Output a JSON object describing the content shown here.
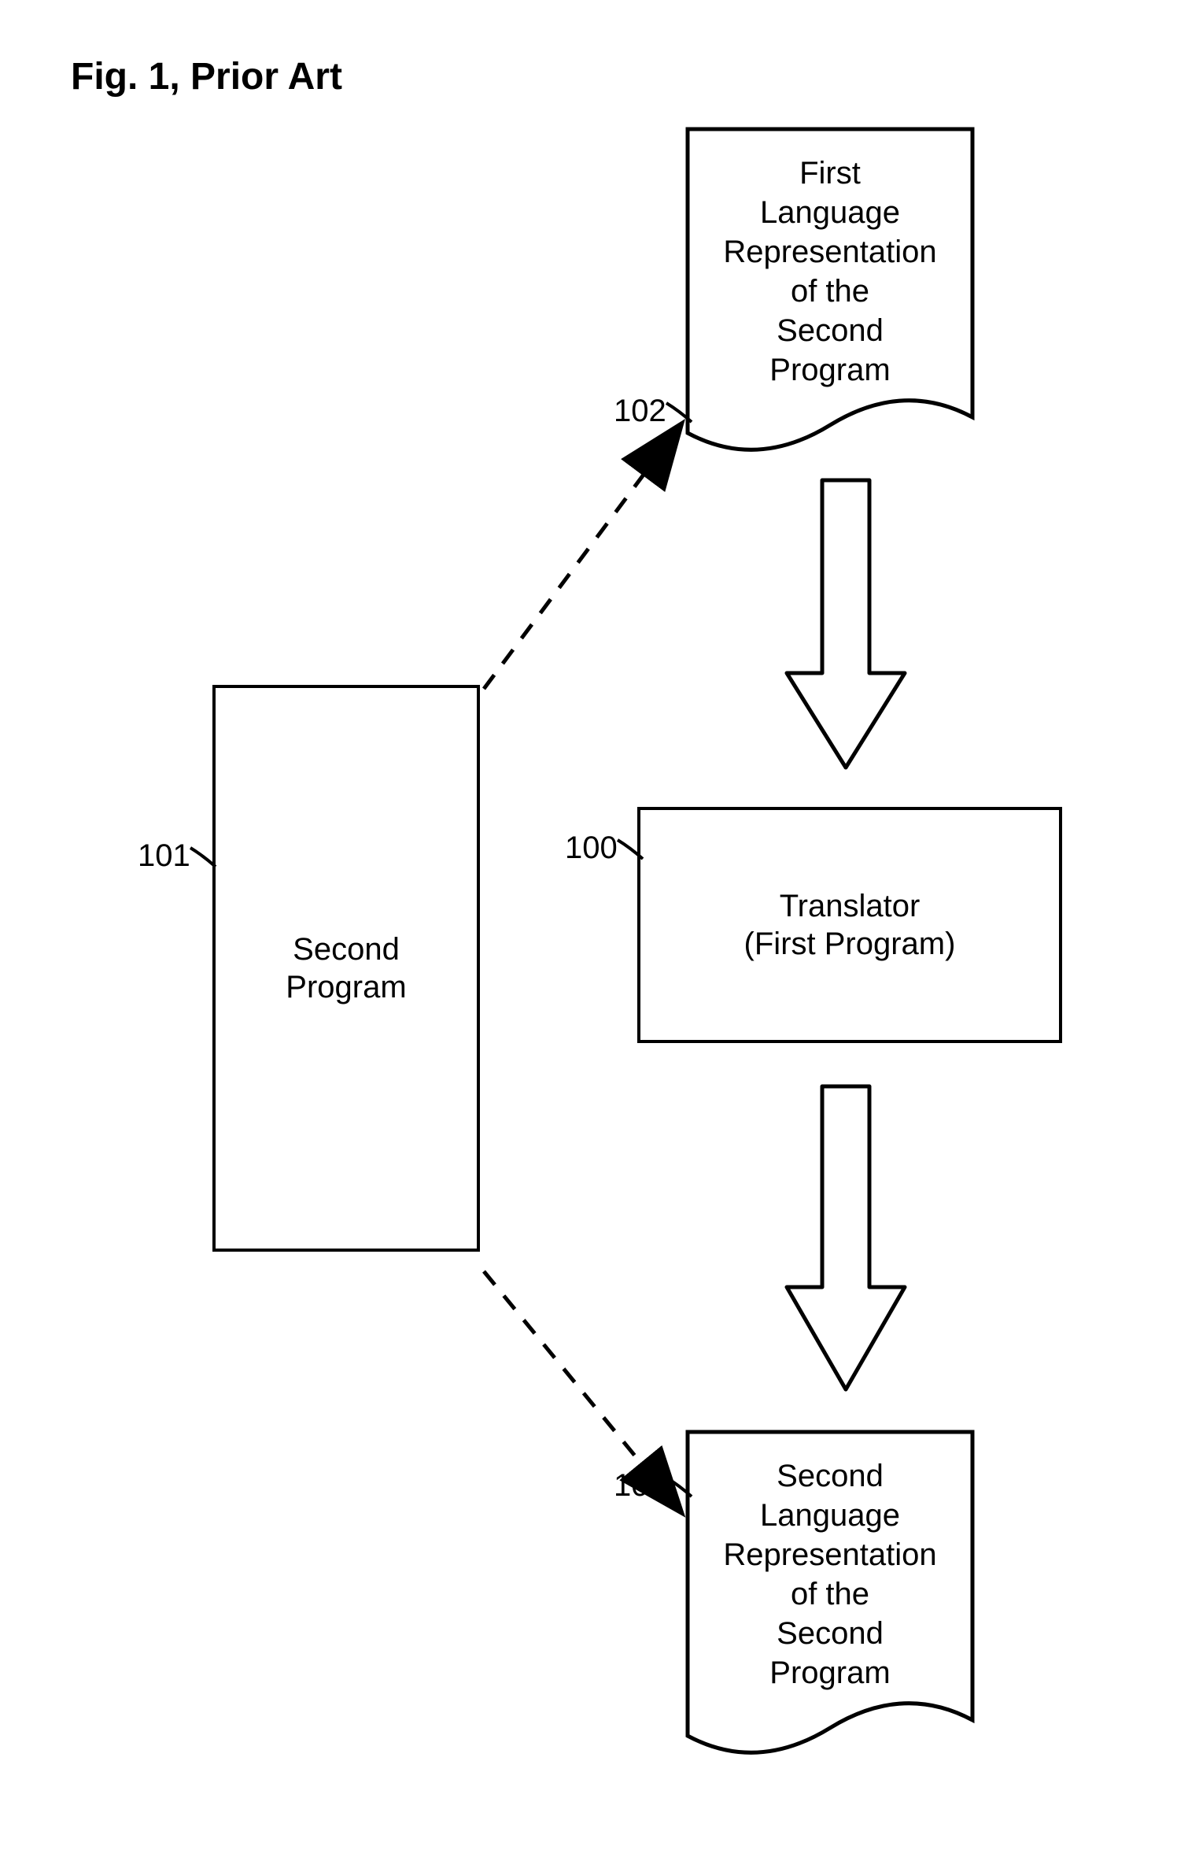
{
  "title": "Fig.  1, Prior Art",
  "nodes": {
    "second_program": {
      "ref": "101",
      "label_line1": "Second",
      "label_line2": "Program"
    },
    "first_lang_rep": {
      "ref": "102",
      "l1": "First",
      "l2": "Language",
      "l3": "Representation",
      "l4": "of the",
      "l5": "Second",
      "l6": "Program"
    },
    "translator": {
      "ref": "100",
      "label_line1": "Translator",
      "label_line2": "(First Program)"
    },
    "second_lang_rep": {
      "ref": "103",
      "l1": "Second",
      "l2": "Language",
      "l3": "Representation",
      "l4": "of the",
      "l5": "Second",
      "l6": "Program"
    }
  }
}
